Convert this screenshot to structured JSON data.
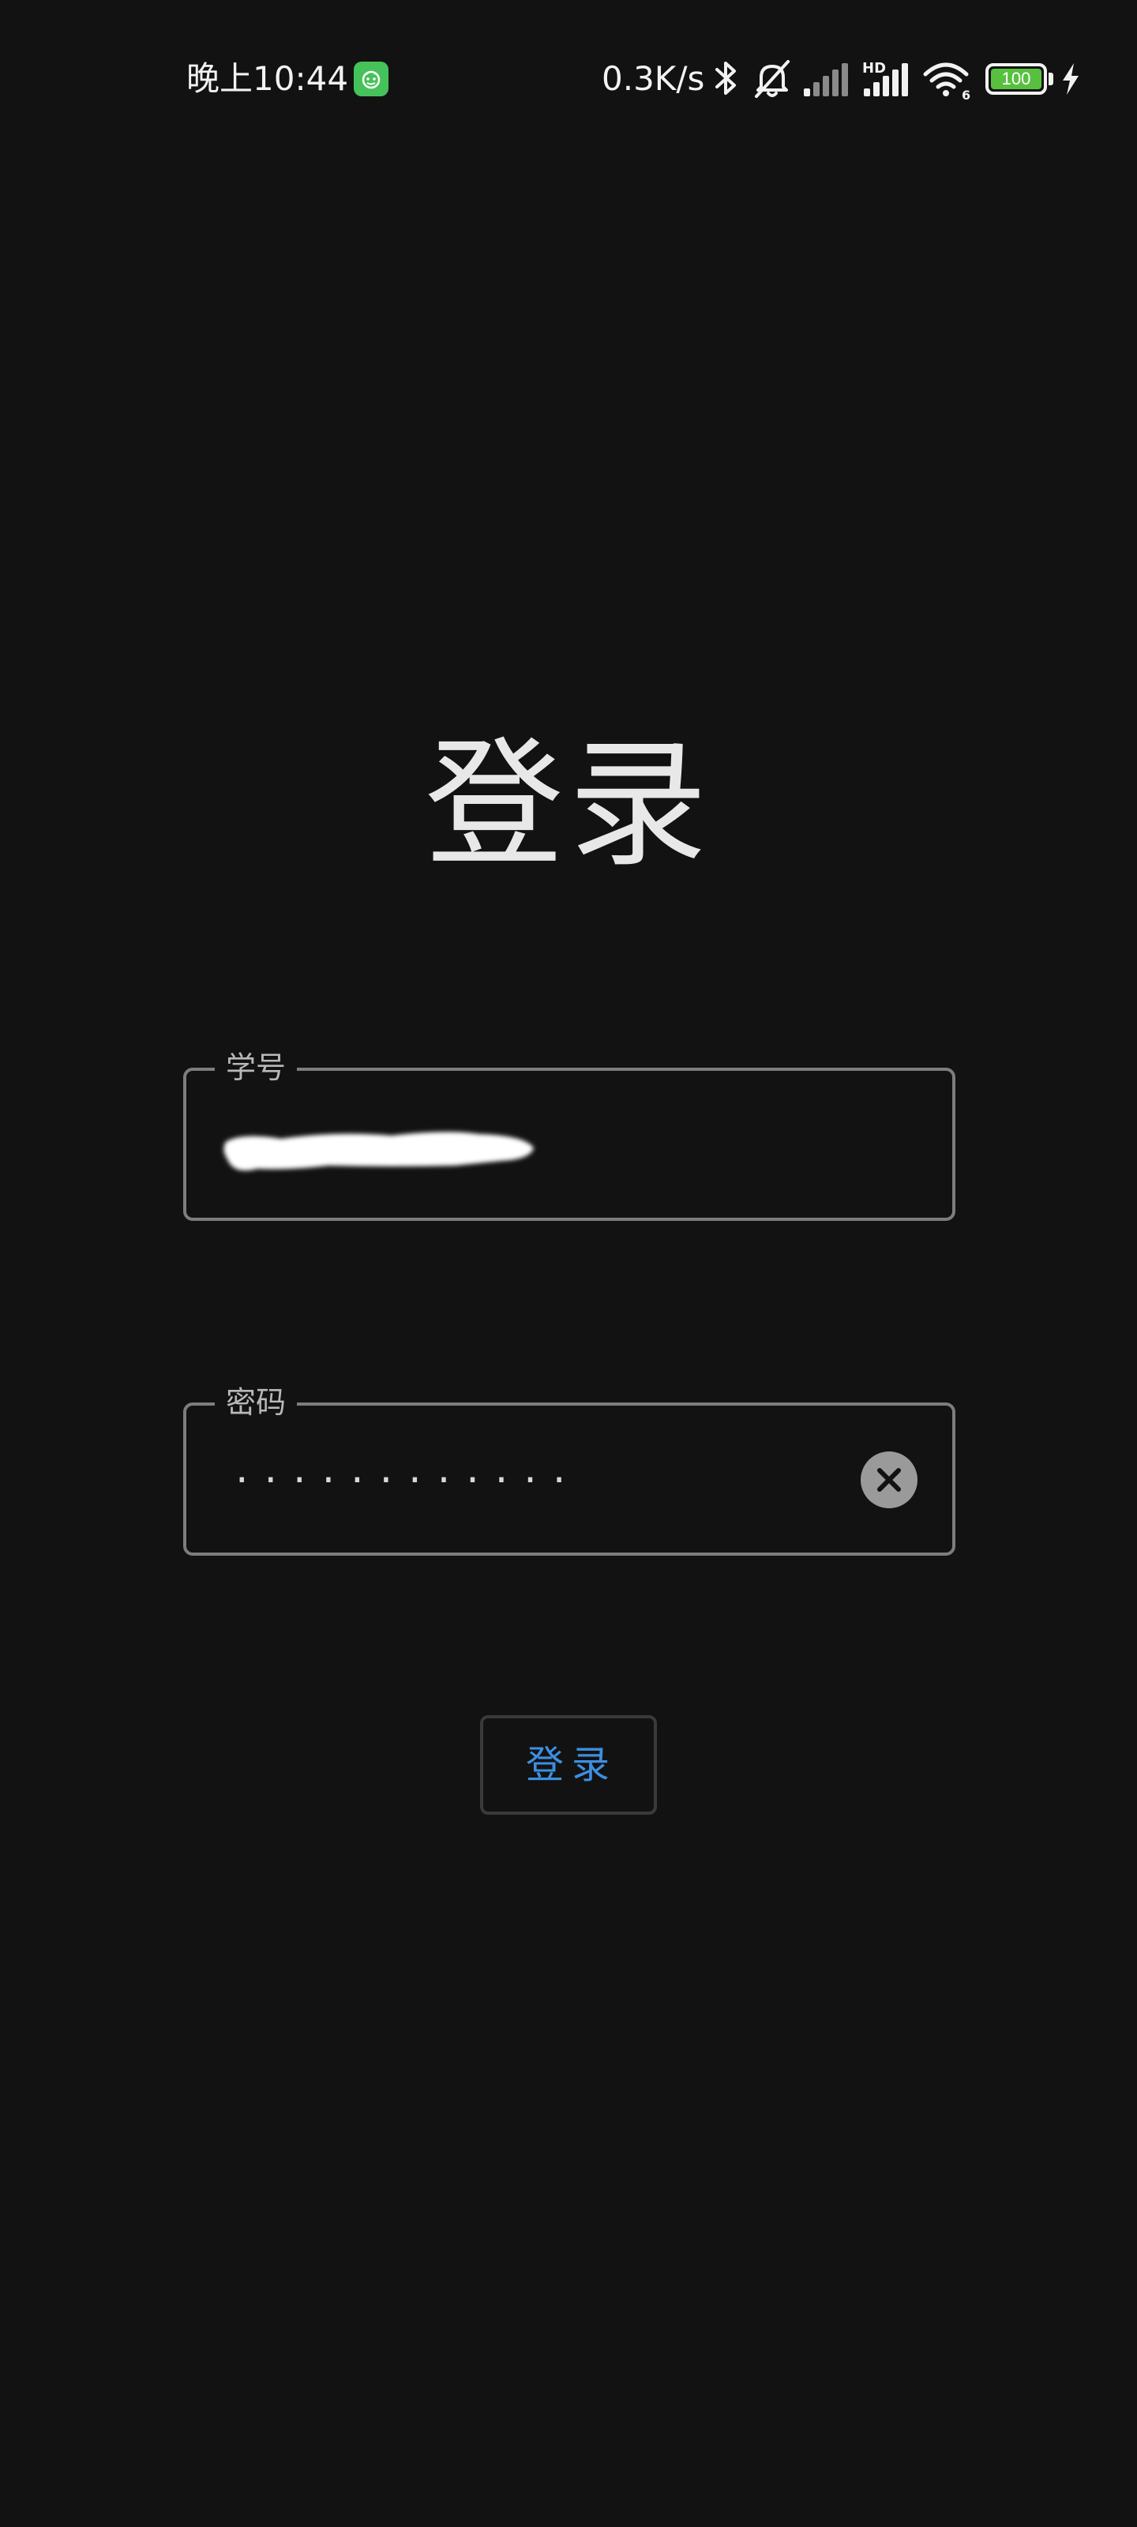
{
  "status_bar": {
    "time": "晚上10:44",
    "network_speed": "0.3K/s",
    "battery_level": "100",
    "battery_color": "#57c13f",
    "app_badge_color": "#46c25a",
    "icons": [
      "app-notification-icon",
      "bluetooth-icon",
      "bell-off-icon",
      "signal-icon",
      "hd-signal-icon",
      "wifi-icon",
      "battery-icon",
      "charging-icon"
    ],
    "signal_badge": "HD",
    "wifi_badge": "6"
  },
  "login": {
    "title": "登录",
    "student_id": {
      "label": "学号",
      "value_redacted": true
    },
    "password": {
      "label": "密码",
      "masked_value": "············"
    },
    "submit_label": "登录",
    "accent_color": "#3d8fe0"
  }
}
